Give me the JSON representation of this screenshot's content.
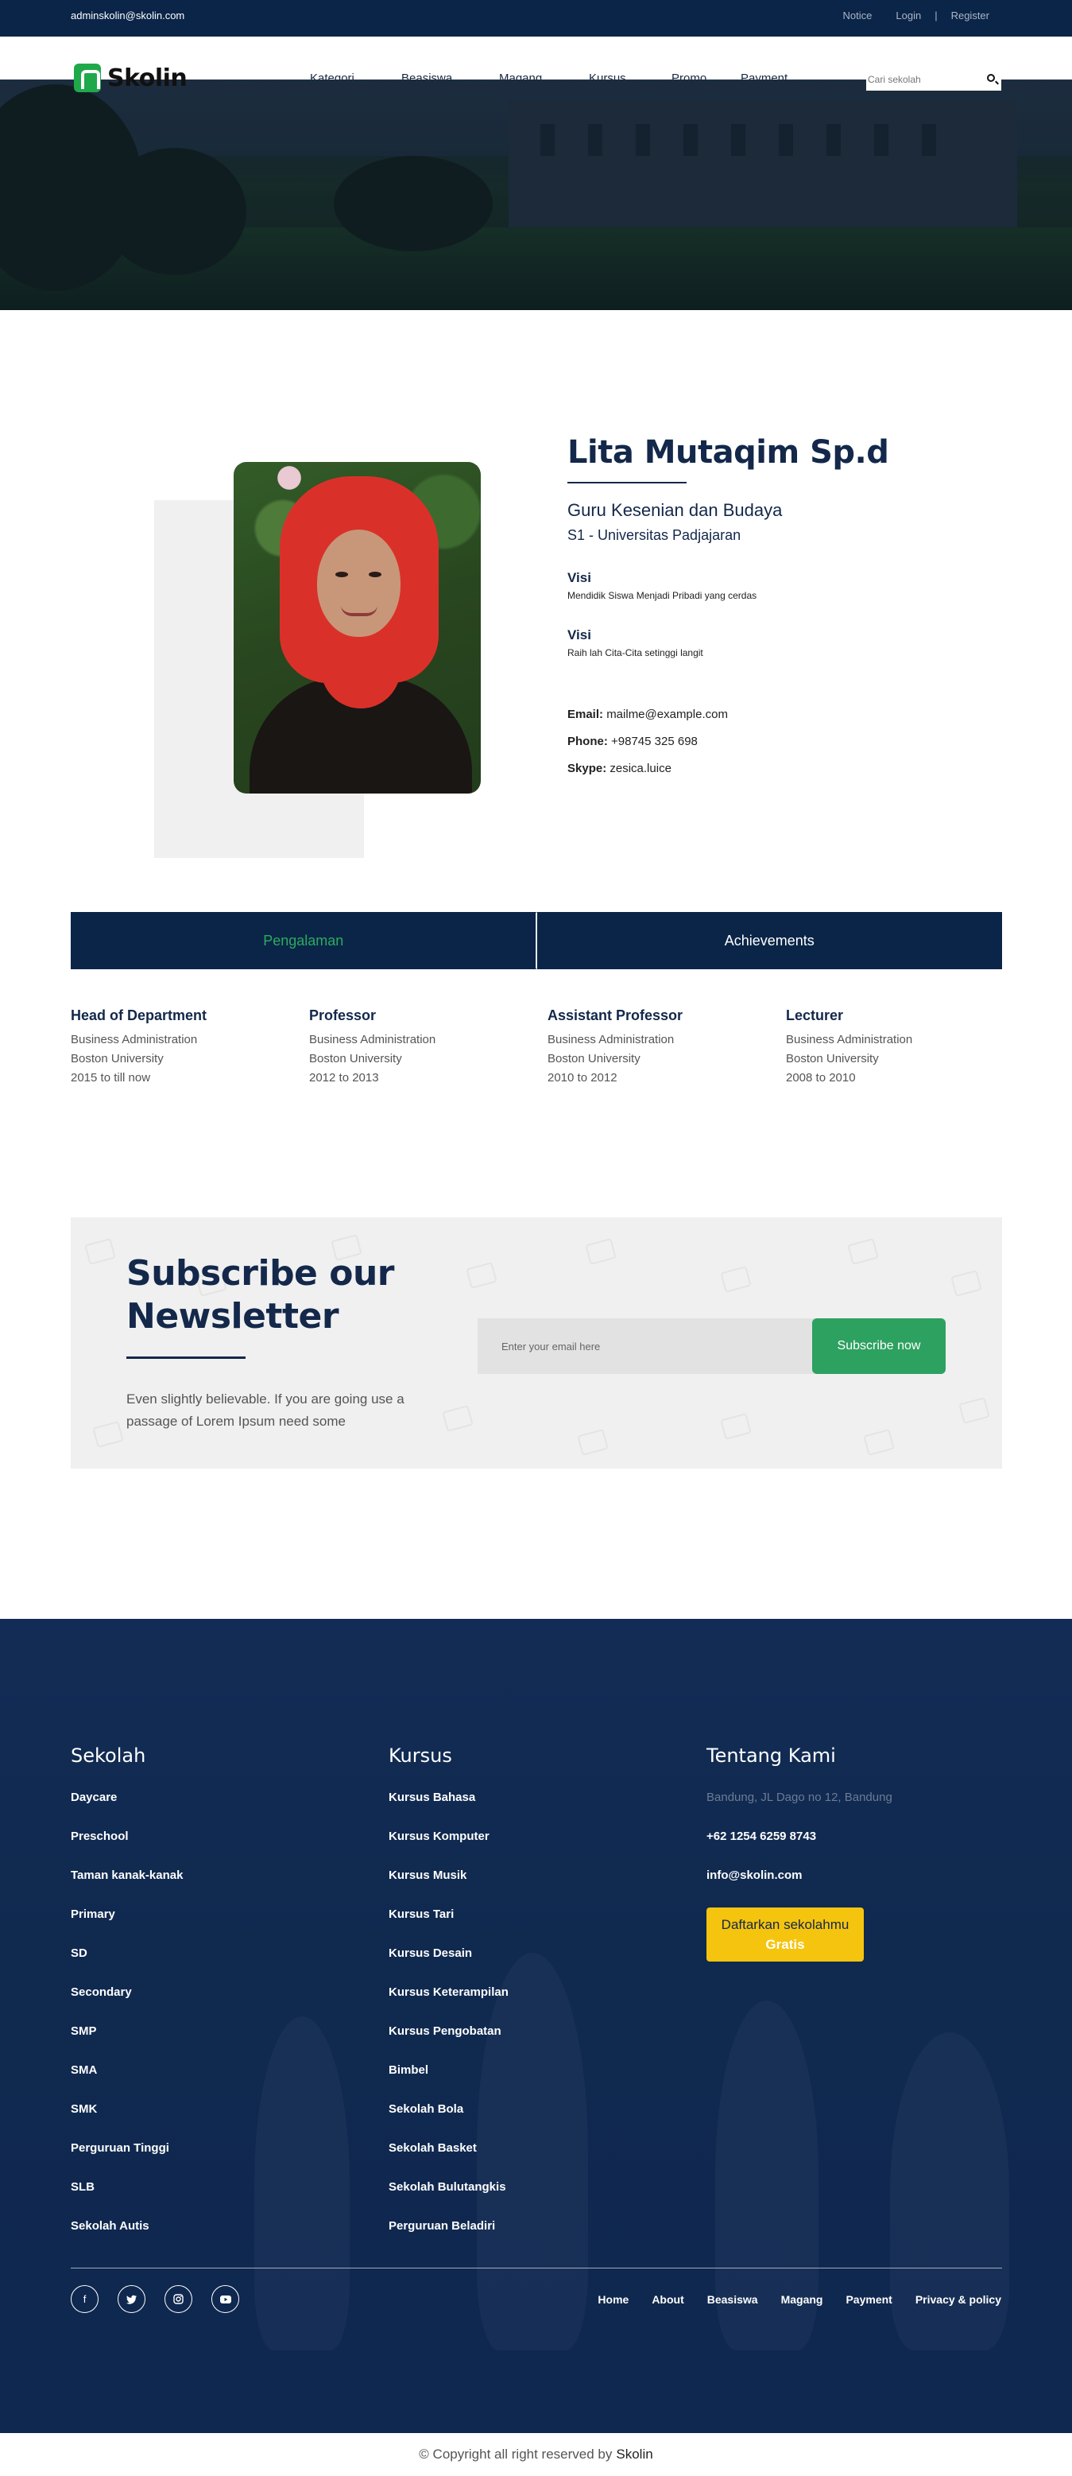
{
  "topbar": {
    "email": "adminskolin@skolin.com",
    "notice": "Notice",
    "login": "Login",
    "separator": "|",
    "register": "Register"
  },
  "nav": {
    "logo_text": "Skolin",
    "items": [
      "Kategori",
      "Beasiswa",
      "Magang",
      "Kursus",
      "Promo",
      "Payment"
    ],
    "search_placeholder": "Cari sekolah"
  },
  "profile": {
    "name": "Lita Mutaqim Sp.d",
    "role": "Guru Kesenian dan Budaya",
    "degree": "S1 - Universitas Padjajaran",
    "visi_label": "Visi",
    "visi_text": "Mendidik Siswa Menjadi Pribadi yang cerdas",
    "misi_label": "Visi",
    "misi_text": "Raih lah Cita-Cita setinggi langit",
    "email_label": "Email:",
    "email": "mailme@example.com",
    "phone_label": "Phone:",
    "phone": "+98745 325 698",
    "skype_label": "Skype:",
    "skype": "zesica.luice"
  },
  "tabs": [
    "Pengalaman",
    "Achievements"
  ],
  "experience": [
    {
      "title": "Head of Department",
      "field": "Business Administration",
      "place": "Boston University",
      "period": "2015 to till now"
    },
    {
      "title": "Professor",
      "field": "Business Administration",
      "place": "Boston University",
      "period": "2012 to 2013"
    },
    {
      "title": "Assistant Professor",
      "field": "Business Administration",
      "place": "Boston University",
      "period": "2010 to 2012"
    },
    {
      "title": "Lecturer",
      "field": "Business Administration",
      "place": "Boston University",
      "period": "2008 to 2010"
    }
  ],
  "newsletter": {
    "title": "Subscribe our Newsletter",
    "text": "Even slightly believable. If you are going use a passage of Lorem Ipsum need some",
    "email_placeholder": "Enter your email here",
    "button": "Subscribe now"
  },
  "footer": {
    "sekolah": {
      "title": "Sekolah",
      "items": [
        "Daycare",
        "Preschool",
        "Taman kanak-kanak",
        "Primary",
        "SD",
        "Secondary",
        "SMP",
        "SMA",
        "SMK",
        "Perguruan Tinggi",
        "SLB",
        "Sekolah Autis"
      ]
    },
    "kursus": {
      "title": "Kursus",
      "items": [
        "Kursus Bahasa",
        "Kursus Komputer",
        "Kursus Musik",
        "Kursus Tari",
        "Kursus Desain",
        "Kursus Keterampilan",
        "Kursus Pengobatan",
        "Bimbel",
        "Sekolah Bola",
        "Sekolah Basket",
        "Sekolah Bulutangkis",
        "Perguruan Beladiri"
      ]
    },
    "tentang": {
      "title": "Tentang Kami",
      "address": "Bandung, JL Dago no 12, Bandung",
      "phone": "+62 1254 6259 8743",
      "email": "info@skolin.com",
      "cta_line1": "Daftarkan sekolahmu",
      "cta_line2": "Gratis"
    },
    "social_icons": [
      "facebook-icon",
      "twitter-icon",
      "instagram-icon",
      "youtube-icon"
    ],
    "links": [
      "Home",
      "About",
      "Beasiswa",
      "Magang",
      "Payment",
      "Privacy & policy"
    ]
  },
  "copyright": {
    "text": "© Copyright all right reserved by",
    "brand": "Skolin"
  },
  "colors": {
    "navy": "#0b2548",
    "green": "#2bab5e",
    "yellow": "#f5c40e"
  }
}
